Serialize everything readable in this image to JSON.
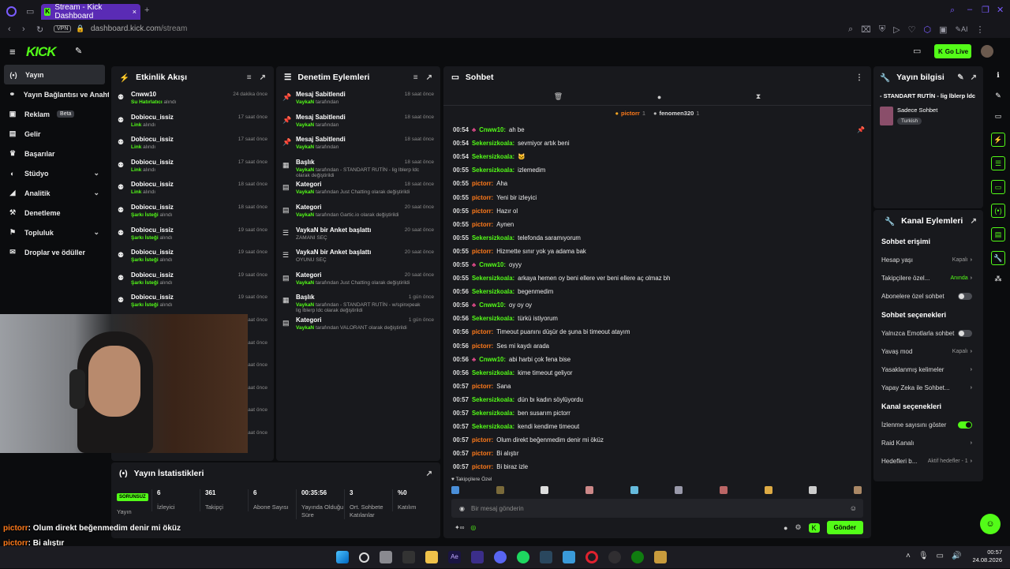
{
  "browser": {
    "tab_title": "Stream - Kick Dashboard",
    "url_host": "dashboard.kick.com",
    "url_path": "/stream",
    "vpn": "VPN",
    "ai": "AI"
  },
  "header": {
    "logo": "KICK",
    "go_live": "Go Live"
  },
  "sidebar": {
    "items": [
      {
        "label": "Yayın",
        "icon": "broadcast-icon"
      },
      {
        "label": "Yayın Bağlantısı ve Anahtarı",
        "icon": "link-icon"
      },
      {
        "label": "Reklam",
        "icon": "ad-icon",
        "badge": "Beta"
      },
      {
        "label": "Gelir",
        "icon": "wallet-icon"
      },
      {
        "label": "Başarılar",
        "icon": "trophy-icon"
      },
      {
        "label": "Stüdyo",
        "icon": "studio-icon",
        "chevron": true
      },
      {
        "label": "Analitik",
        "icon": "chart-icon",
        "chevron": true
      },
      {
        "label": "Denetleme",
        "icon": "hammer-icon"
      },
      {
        "label": "Topluluk",
        "icon": "community-icon",
        "chevron": true
      },
      {
        "label": "Droplar ve ödüller",
        "icon": "gift-icon"
      }
    ]
  },
  "activity": {
    "title": "Etkinlik Akışı",
    "events": [
      {
        "name": "Cnww10",
        "desc": "Su Hatırlatıcı",
        "suffix": " alındı",
        "time": "24 dakika önce"
      },
      {
        "name": "Dobiocu_issiz",
        "desc": "Link",
        "suffix": " alındı",
        "time": "17 saat önce"
      },
      {
        "name": "Dobiocu_issiz",
        "desc": "Link",
        "suffix": " alındı",
        "time": "17 saat önce"
      },
      {
        "name": "Dobiocu_issiz",
        "desc": "Link",
        "suffix": " alındı",
        "time": "17 saat önce"
      },
      {
        "name": "Dobiocu_issiz",
        "desc": "Link",
        "suffix": " alındı",
        "time": "18 saat önce"
      },
      {
        "name": "Dobiocu_issiz",
        "desc": "Şarkı İsteği",
        "suffix": " alındı",
        "time": "18 saat önce"
      },
      {
        "name": "Dobiocu_issiz",
        "desc": "Şarkı İsteği",
        "suffix": " alındı",
        "time": "19 saat önce"
      },
      {
        "name": "Dobiocu_issiz",
        "desc": "Şarkı İsteği",
        "suffix": " alındı",
        "time": "19 saat önce"
      },
      {
        "name": "Dobiocu_issiz",
        "desc": "Şarkı İsteği",
        "suffix": " alındı",
        "time": "19 saat önce"
      },
      {
        "name": "Dobiocu_issiz",
        "desc": "Şarkı İsteği",
        "suffix": " alındı",
        "time": "19 saat önce"
      }
    ],
    "hidden_times": [
      "saat önce",
      "saat önce",
      "saat önce",
      "saat önce",
      "saat önce",
      "saat önce"
    ]
  },
  "moderation": {
    "title": "Denetim Eylemleri",
    "events": [
      {
        "icon": "pin-icon",
        "name": "Mesaj Sabitlendi",
        "user": "VaykaN",
        "rest": " tarafından",
        "rest2": "",
        "time": "18 saat önce"
      },
      {
        "icon": "pin-icon",
        "name": "Mesaj Sabitlendi",
        "user": "VaykaN",
        "rest": " tarafından",
        "rest2": "",
        "time": "18 saat önce"
      },
      {
        "icon": "pin-icon",
        "name": "Mesaj Sabitlendi",
        "user": "VaykaN",
        "rest": " tarafından",
        "rest2": "",
        "time": "18 saat önce"
      },
      {
        "icon": "title-icon",
        "name": "Başlık",
        "user": "VaykaN",
        "rest": " tarafından - STANDART RUTİN - lig lblerp ldc",
        "rest2": "olarak değiştirildi",
        "time": "18 saat önce"
      },
      {
        "icon": "category-icon",
        "name": "Kategori",
        "user": "VaykaN",
        "rest": " tarafından Just Chatting olarak değiştirildi",
        "rest2": "",
        "time": "18 saat önce"
      },
      {
        "icon": "category-icon",
        "name": "Kategori",
        "user": "VaykaN",
        "rest": " tarafından Gartic.io olarak değiştirildi",
        "rest2": "",
        "time": "20 saat önce"
      },
      {
        "icon": "poll-icon",
        "name": "VaykaN bir Anket başlattı",
        "user": "",
        "rest": "ZAMANI SEÇ",
        "rest2": "",
        "time": "20 saat önce"
      },
      {
        "icon": "poll-icon",
        "name": "VaykaN bir Anket başlattı",
        "user": "",
        "rest": "OYUNU SEÇ",
        "rest2": "",
        "time": "20 saat önce"
      },
      {
        "icon": "category-icon",
        "name": "Kategori",
        "user": "VaykaN",
        "rest": " tarafından Just Chatting olarak değiştirildi",
        "rest2": "",
        "time": "20 saat önce"
      },
      {
        "icon": "title-icon",
        "name": "Başlık",
        "user": "VaykaN",
        "rest": " tarafından - STANDART RUTİN - w/spinxpeak",
        "rest2": "lig lblerp ldc olarak değiştirildi",
        "time": "1 gün önce"
      },
      {
        "icon": "category-icon",
        "name": "Kategori",
        "user": "VaykaN",
        "rest": " tarafından VALORANT olarak değiştirildi",
        "rest2": "",
        "time": "1 gün önce"
      }
    ]
  },
  "stats": {
    "title": "Yayın İstatistikleri",
    "status": "SORUNSUZ",
    "status_label": "Yayın",
    "items": [
      {
        "value": "6",
        "label": "İzleyici"
      },
      {
        "value": "361",
        "label": "Takipçi"
      },
      {
        "value": "6",
        "label": "Abone Sayısı"
      },
      {
        "value": "00:35:56",
        "label": "Yayında Olduğu Süre"
      },
      {
        "value": "3",
        "label": "Ort. Sohbete Katılanlar"
      },
      {
        "value": "%0",
        "label": "Katılım"
      }
    ]
  },
  "chat": {
    "title": "Sohbet",
    "top_users": [
      {
        "name": "pictorr",
        "count": "1"
      },
      {
        "name": "fenomen320",
        "count": "1"
      }
    ],
    "messages": [
      {
        "t": "00:54",
        "u": "Cnww10",
        "c": "#53fc18",
        "m": "ah be",
        "badge": true
      },
      {
        "t": "00:54",
        "u": "Sekersizkoala",
        "c": "#53fc18",
        "m": "sevmiyor artık beni"
      },
      {
        "t": "00:54",
        "u": "Sekersizkoala",
        "c": "#53fc18",
        "m": "🐱"
      },
      {
        "t": "00:55",
        "u": "Sekersizkoala",
        "c": "#53fc18",
        "m": "izlemedim"
      },
      {
        "t": "00:55",
        "u": "pictorr",
        "c": "#ff7a1a",
        "m": "Aha"
      },
      {
        "t": "00:55",
        "u": "pictorr",
        "c": "#ff7a1a",
        "m": "Yeni bir izleyici"
      },
      {
        "t": "00:55",
        "u": "pictorr",
        "c": "#ff7a1a",
        "m": "Hazır ol"
      },
      {
        "t": "00:55",
        "u": "pictorr",
        "c": "#ff7a1a",
        "m": "Aynen"
      },
      {
        "t": "00:55",
        "u": "Sekersizkoala",
        "c": "#53fc18",
        "m": "telefonda saramıyorum"
      },
      {
        "t": "00:55",
        "u": "pictorr",
        "c": "#ff7a1a",
        "m": "Hizmette sınır yok ya adama bak"
      },
      {
        "t": "00:55",
        "u": "Cnww10",
        "c": "#53fc18",
        "m": "oyyy",
        "badge": true
      },
      {
        "t": "00:55",
        "u": "Sekersizkoala",
        "c": "#53fc18",
        "m": "arkaya hemen oy beni ellere ver beni ellere aç olmaz bh"
      },
      {
        "t": "00:56",
        "u": "Sekersizkoala",
        "c": "#53fc18",
        "m": "begenmedim"
      },
      {
        "t": "00:56",
        "u": "Cnww10",
        "c": "#53fc18",
        "m": "oy oy oy",
        "badge": true
      },
      {
        "t": "00:56",
        "u": "Sekersizkoala",
        "c": "#53fc18",
        "m": "türkü istiyorum"
      },
      {
        "t": "00:56",
        "u": "pictorr",
        "c": "#ff7a1a",
        "m": "Timeout puanını düşür de şuna bi timeout atayım"
      },
      {
        "t": "00:56",
        "u": "pictorr",
        "c": "#ff7a1a",
        "m": "Ses mi kaydı arada"
      },
      {
        "t": "00:56",
        "u": "Cnww10",
        "c": "#53fc18",
        "m": "abi harbi çok fena bise",
        "badge": true
      },
      {
        "t": "00:56",
        "u": "Sekersizkoala",
        "c": "#53fc18",
        "m": "kime timeout geliyor"
      },
      {
        "t": "00:57",
        "u": "pictorr",
        "c": "#ff7a1a",
        "m": "Sana"
      },
      {
        "t": "00:57",
        "u": "Sekersizkoala",
        "c": "#53fc18",
        "m": "dün bı kadın söylüyordu"
      },
      {
        "t": "00:57",
        "u": "Sekersizkoala",
        "c": "#53fc18",
        "m": "ben susarım pictorr"
      },
      {
        "t": "00:57",
        "u": "Sekersizkoala",
        "c": "#53fc18",
        "m": "kendi kendime timeout"
      },
      {
        "t": "00:57",
        "u": "pictorr",
        "c": "#ff7a1a",
        "m": "Olum direkt beğenmedim denir mi öküz"
      },
      {
        "t": "00:57",
        "u": "pictorr",
        "c": "#ff7a1a",
        "m": "Bi alıştır"
      },
      {
        "t": "00:57",
        "u": "pictorr",
        "c": "#ff7a1a",
        "m": "Bi biraz izle"
      }
    ],
    "followers_only": "Takipçilere Özel",
    "placeholder": "Bir mesaj gönderin",
    "send": "Gönder"
  },
  "stream_info": {
    "title": "Yayın bilgisi",
    "stream_title": "- STANDART RUTİN - lig lblerp ldc",
    "mode": "Sadece Sohbet",
    "tag": "Turkish"
  },
  "channel_actions": {
    "title": "Kanal Eylemleri",
    "chat_access": "Sohbet erişimi",
    "rows1": [
      {
        "label": "Hesap yaşı",
        "value": "Kapalı"
      },
      {
        "label": "Takipçilere özel...",
        "value": "Anında"
      },
      {
        "label": "Abonelere özel sohbet",
        "toggle": false
      }
    ],
    "chat_options": "Sohbet seçenekleri",
    "rows2": [
      {
        "label": "Yalnızca Emotlarla sohbet",
        "toggle": false
      },
      {
        "label": "Yavaş mod",
        "value": "Kapalı"
      },
      {
        "label": "Yasaklanmış kelimeler",
        "value": ""
      },
      {
        "label": "Yapay Zeka ile Sohbet...",
        "value": ""
      }
    ],
    "channel_options": "Kanal seçenekleri",
    "rows3": [
      {
        "label": "İzlenme sayısını göster",
        "toggle": true
      },
      {
        "label": "Raid Kanalı",
        "value": ""
      },
      {
        "label": "Hedefleri b...",
        "value": "Aktif hedefler - 1"
      }
    ]
  },
  "overlay_chat": [
    {
      "u": "pictorr",
      "m": ": Olum direkt beğenmedim denir mi öküz"
    },
    {
      "u": "pictorr",
      "m": ": Bi alıştır"
    },
    {
      "u": "pictorr",
      "m": ": Bi biraz izle"
    }
  ],
  "taskbar": {
    "time": "00:57",
    "date": "24.08.2026"
  }
}
